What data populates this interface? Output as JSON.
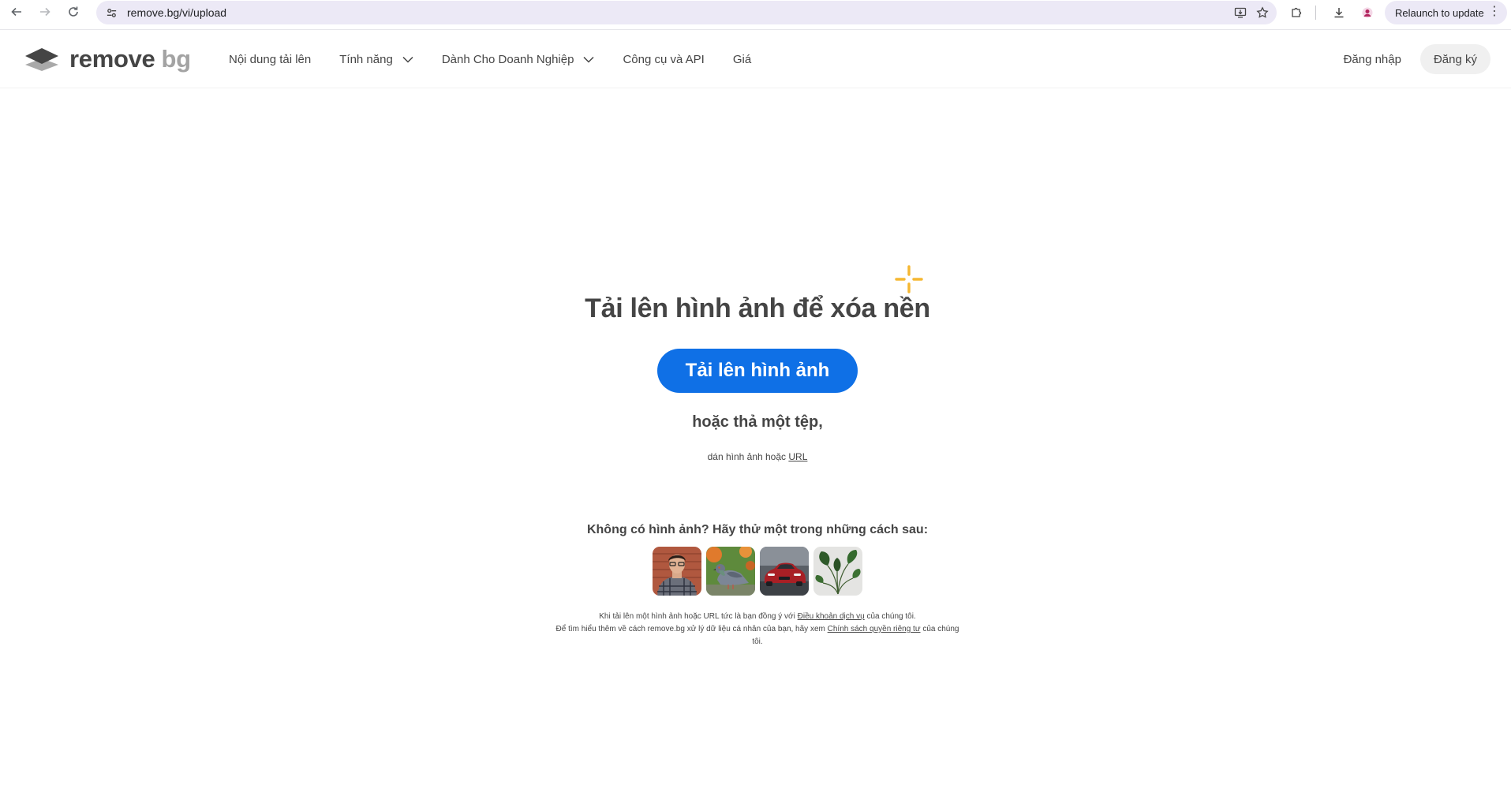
{
  "browser": {
    "url": "remove.bg/vi/upload",
    "relaunch_label": "Relaunch to update"
  },
  "header": {
    "logo_word1": "remove",
    "logo_word2": "bg",
    "menu": [
      {
        "label": "Nội dung tải lên",
        "has_dropdown": false
      },
      {
        "label": "Tính năng",
        "has_dropdown": true
      },
      {
        "label": "Dành Cho Doanh Nghiệp",
        "has_dropdown": true
      },
      {
        "label": "Công cụ và API",
        "has_dropdown": false
      },
      {
        "label": "Giá",
        "has_dropdown": false
      }
    ],
    "login_label": "Đăng nhập",
    "signup_label": "Đăng ký"
  },
  "main": {
    "title": "Tải lên hình ảnh để xóa nền",
    "upload_button_label": "Tải lên hình ảnh",
    "drop_text": "hoặc thả một tệp,",
    "paste_text": "dán hình ảnh hoặc",
    "paste_link": "URL",
    "try_text": "Không có hình ảnh? Hãy thử một trong những cách sau:",
    "samples": [
      "sample-person",
      "sample-pigeon",
      "sample-car",
      "sample-plant"
    ],
    "terms": {
      "line1_before": "Khi tải lên một hình ảnh hoặc URL tức là bạn đồng ý với",
      "line1_link": "Điều khoản dịch vụ",
      "line1_after": "của chúng tôi.",
      "line2_before": "Để tìm hiểu thêm về cách remove.bg xử lý dữ liệu cá nhân của bạn, hãy xem",
      "line2_link": "Chính sách quyền riêng tư",
      "line2_after": "của chúng tôi."
    }
  },
  "colors": {
    "primary": "#0f70e6",
    "text": "#454545",
    "sparkle": "#f5b731"
  }
}
